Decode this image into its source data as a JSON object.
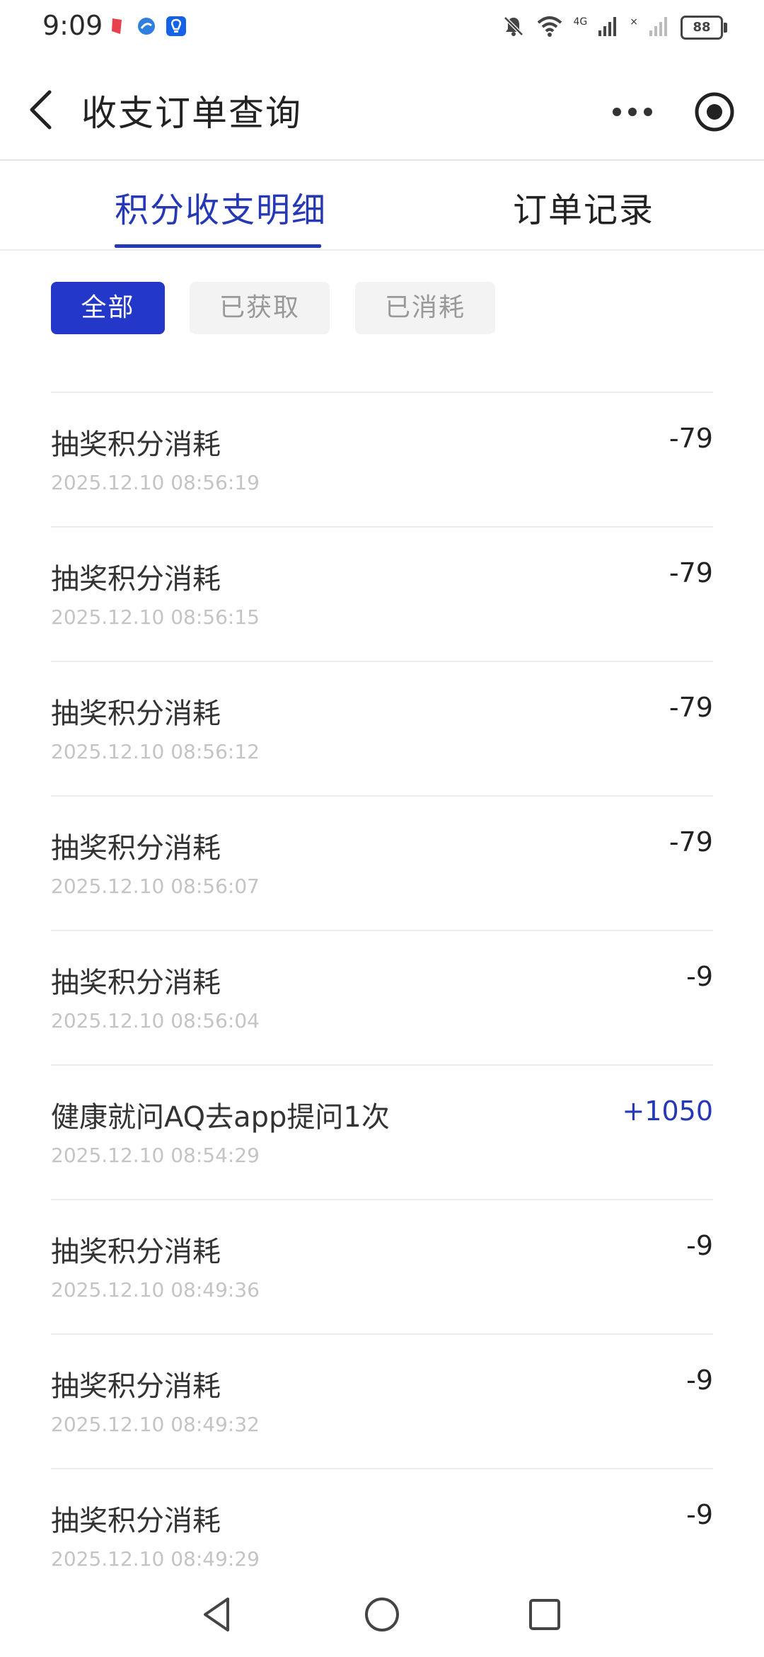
{
  "status_bar": {
    "time": "9:09",
    "network_label": "4G",
    "sim2_mark": "×",
    "battery": "88",
    "icons": [
      "red-app-icon",
      "blue-app-icon",
      "shield-app-icon",
      "mute-icon",
      "wifi-icon",
      "signal-icon",
      "signal-2-icon"
    ]
  },
  "header": {
    "title": "收支订单查询",
    "icons": [
      "back-icon",
      "more-icon",
      "target-icon"
    ]
  },
  "tabs": [
    {
      "label": "积分收支明细",
      "active": true
    },
    {
      "label": "订单记录",
      "active": false
    }
  ],
  "filters": [
    {
      "label": "全部",
      "active": true
    },
    {
      "label": "已获取",
      "active": false
    },
    {
      "label": "已消耗",
      "active": false
    }
  ],
  "records": [
    {
      "title": "抽奖积分消耗",
      "time": "2025.12.10 08:56:19",
      "amount": "-79"
    },
    {
      "title": "抽奖积分消耗",
      "time": "2025.12.10 08:56:15",
      "amount": "-79"
    },
    {
      "title": "抽奖积分消耗",
      "time": "2025.12.10 08:56:12",
      "amount": "-79"
    },
    {
      "title": "抽奖积分消耗",
      "time": "2025.12.10 08:56:07",
      "amount": "-79"
    },
    {
      "title": "抽奖积分消耗",
      "time": "2025.12.10 08:56:04",
      "amount": "-9"
    },
    {
      "title": "健康就问AQ去app提问1次",
      "time": "2025.12.10 08:54:29",
      "amount": "+1050"
    },
    {
      "title": "抽奖积分消耗",
      "time": "2025.12.10 08:49:36",
      "amount": "-9"
    },
    {
      "title": "抽奖积分消耗",
      "time": "2025.12.10 08:49:32",
      "amount": "-9"
    },
    {
      "title": "抽奖积分消耗",
      "time": "2025.12.10 08:49:29",
      "amount": "-9"
    }
  ],
  "colors": {
    "accent": "#2539b5",
    "filter_active_bg": "#2338c9",
    "positive_amount": "#2539b5",
    "timestamp": "#c4c4c4"
  },
  "nav_bar": {
    "icons": [
      "back-triangle-icon",
      "home-circle-icon",
      "recents-square-icon"
    ]
  }
}
